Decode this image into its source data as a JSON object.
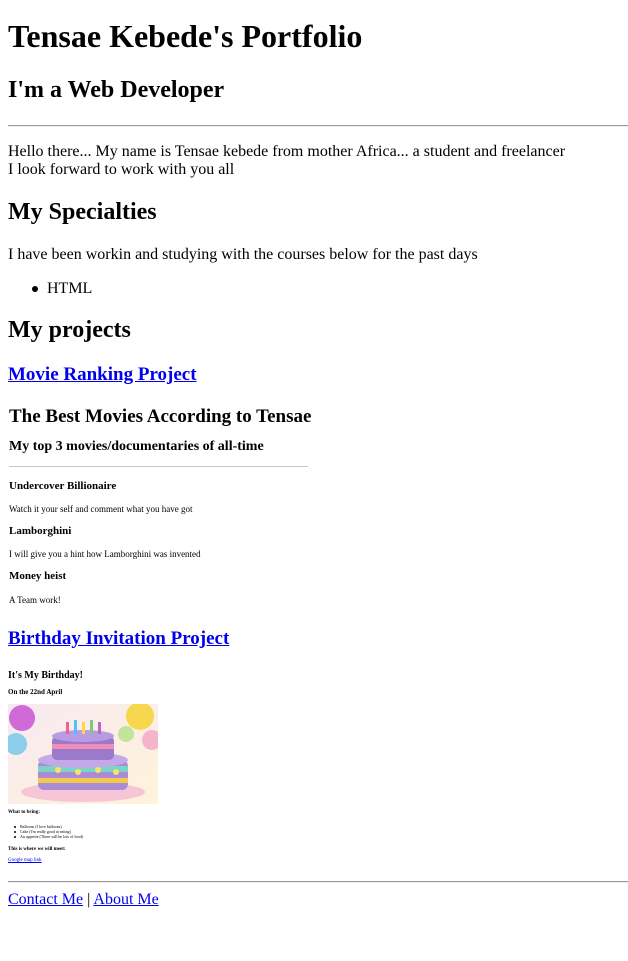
{
  "header": {
    "title": "Tensae Kebede's Portfolio",
    "subtitle": "I'm a Web Developer"
  },
  "intro": {
    "line1": "Hello there... My name is Tensae kebede from mother Africa... a student and freelancer",
    "line2": "I look forward to work with you all"
  },
  "specialties": {
    "heading": "My Specialties",
    "text": "I have been workin and studying with the courses below for the past days",
    "items": [
      "HTML"
    ]
  },
  "projects": {
    "heading": "My projects",
    "movie": {
      "link": "Movie Ranking Project",
      "title": "The Best Movies According to Tensae",
      "subtitle": "My top 3 movies/documentaries of all-time",
      "items": [
        {
          "name": "Undercover Billionaire",
          "desc": "Watch it your self and comment what you have got"
        },
        {
          "name": "Lamborghini",
          "desc": "I will give you a hint how Lamborghini was invented"
        },
        {
          "name": "Money heist",
          "desc": "A Team work!"
        }
      ]
    },
    "birthday": {
      "link": "Birthday Invitation Project",
      "title": "It's My Birthday!",
      "date": "On the 22nd April",
      "bring_heading": "What to bring:",
      "bring_items": [
        "Balloons (I love balloons)",
        "Cake (I'm really good at eating)",
        "An appetite (There will be lots of food)"
      ],
      "meet_heading": "This is where we will meet:",
      "map_link": "Google map link"
    }
  },
  "footer": {
    "contact": "Contact Me",
    "separator": "|",
    "about": "About Me"
  },
  "colors": {
    "link": "#0000ee",
    "text": "#000000"
  }
}
